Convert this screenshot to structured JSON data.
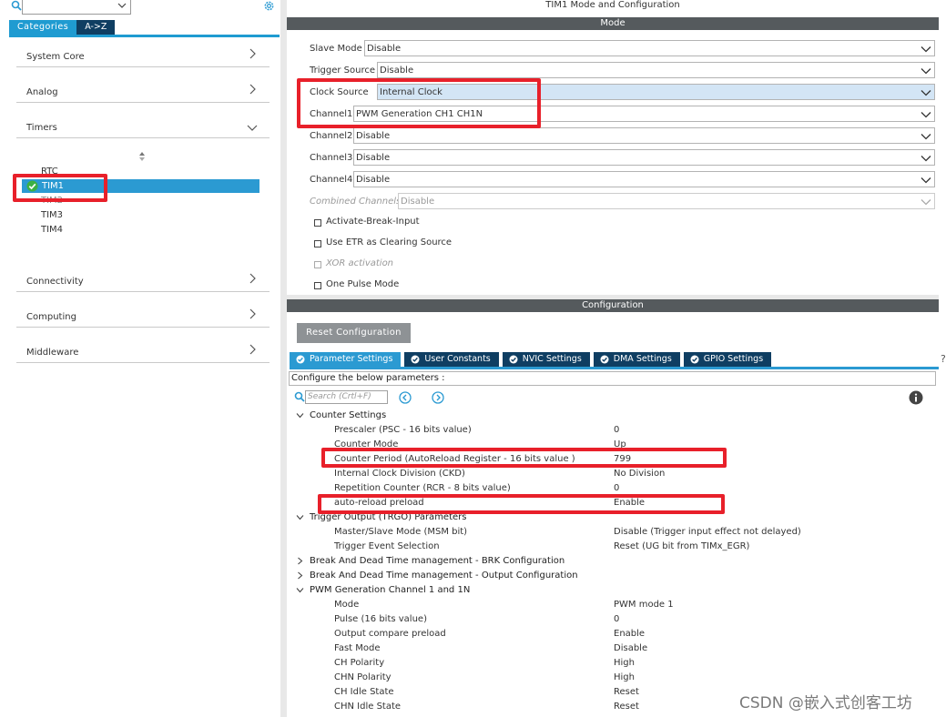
{
  "left": {
    "tabs": [
      {
        "label": "Categories"
      },
      {
        "label": "A->Z"
      }
    ],
    "categories": [
      {
        "label": "System Core"
      },
      {
        "label": "Analog"
      },
      {
        "label": "Timers"
      },
      {
        "label": "Connectivity"
      },
      {
        "label": "Computing"
      },
      {
        "label": "Middleware"
      }
    ],
    "timers": [
      "RTC",
      "TIM2",
      "TIM3",
      "TIM4"
    ],
    "selected_timer": "TIM1"
  },
  "mode": {
    "window_title": "TIM1 Mode and Configuration",
    "section_title": "Mode",
    "fields": [
      {
        "label": "Slave Mode",
        "value": "Disable"
      },
      {
        "label": "Trigger Source",
        "value": "Disable"
      },
      {
        "label": "Clock Source",
        "value": "Internal Clock"
      },
      {
        "label": "Channel1",
        "value": "PWM Generation CH1 CH1N"
      },
      {
        "label": "Channel2",
        "value": "Disable"
      },
      {
        "label": "Channel3",
        "value": "Disable"
      },
      {
        "label": "Channel4",
        "value": "Disable"
      },
      {
        "label": "Combined Channels",
        "value": "Disable"
      }
    ],
    "checkboxes": [
      {
        "label": "Activate-Break-Input"
      },
      {
        "label": "Use ETR as Clearing Source"
      },
      {
        "label": "XOR activation"
      },
      {
        "label": "One Pulse Mode"
      }
    ]
  },
  "config": {
    "section_title": "Configuration",
    "reset_label": "Reset Configuration",
    "tabs": [
      {
        "label": "Parameter Settings"
      },
      {
        "label": "User Constants"
      },
      {
        "label": "NVIC Settings"
      },
      {
        "label": "DMA Settings"
      },
      {
        "label": "GPIO Settings"
      }
    ],
    "hint": "Configure the below parameters :",
    "search_placeholder": "Search (Crtl+F)",
    "groups": [
      {
        "label": "Counter Settings"
      },
      {
        "label": "Trigger Output (TRGO) Parameters"
      },
      {
        "label": "Break And Dead Time management - BRK Configuration"
      },
      {
        "label": "Break And Dead Time management - Output Configuration"
      },
      {
        "label": "PWM Generation Channel 1 and 1N"
      }
    ],
    "counter_params": [
      {
        "name": "Prescaler (PSC - 16 bits value)",
        "value": "0"
      },
      {
        "name": "Counter Mode",
        "value": "Up"
      },
      {
        "name": "Counter Period (AutoReload Register - 16 bits value )",
        "value": "799"
      },
      {
        "name": "Internal Clock Division (CKD)",
        "value": "No Division"
      },
      {
        "name": "Repetition Counter (RCR - 8 bits value)",
        "value": "0"
      },
      {
        "name": "auto-reload preload",
        "value": "Enable"
      }
    ],
    "trgo_params": [
      {
        "name": "Master/Slave Mode (MSM bit)",
        "value": "Disable (Trigger input effect not delayed)"
      },
      {
        "name": "Trigger Event Selection",
        "value": "Reset (UG bit from TIMx_EGR)"
      }
    ],
    "pwm_params": [
      {
        "name": "Mode",
        "value": "PWM mode 1"
      },
      {
        "name": "Pulse (16 bits value)",
        "value": "0"
      },
      {
        "name": "Output compare preload",
        "value": "Enable"
      },
      {
        "name": "Fast Mode",
        "value": "Disable"
      },
      {
        "name": "CH Polarity",
        "value": "High"
      },
      {
        "name": "CHN Polarity",
        "value": "High"
      },
      {
        "name": "CH Idle State",
        "value": "Reset"
      },
      {
        "name": "CHN Idle State",
        "value": "Reset"
      }
    ]
  },
  "watermark": "CSDN @嵌入式创客工坊",
  "icons": [
    "search-icon",
    "gear-icon",
    "chevron-down-icon",
    "chevron-right-icon",
    "check-circle-icon",
    "sort-icon",
    "info-icon",
    "arrow-left-icon",
    "arrow-right-icon"
  ],
  "colors": {
    "accent": "#2b9ad2",
    "dark_tab": "#0f3e62",
    "bar": "#555a5d",
    "highlight": "#e8202a"
  }
}
